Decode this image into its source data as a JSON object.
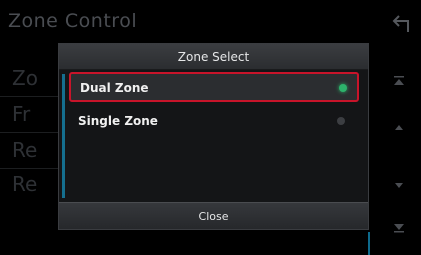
{
  "screen": {
    "title": "Zone Control",
    "bg_rows": [
      "Zo",
      "Fr",
      "Re",
      "Re"
    ]
  },
  "popup": {
    "title": "Zone Select",
    "options": [
      {
        "label": "Dual Zone",
        "selected": true
      },
      {
        "label": "Single Zone",
        "selected": false
      }
    ],
    "close_label": "Close"
  },
  "icons": {
    "back": "back-arrow-icon",
    "top": "scroll-top-icon",
    "up": "scroll-up-icon",
    "down": "scroll-down-icon",
    "bottom": "scroll-bottom-icon"
  },
  "colors": {
    "selected_border": "#c8142a",
    "radio_on": "#2db36b",
    "radio_off": "#4a4c50",
    "accent": "#156f8f"
  }
}
